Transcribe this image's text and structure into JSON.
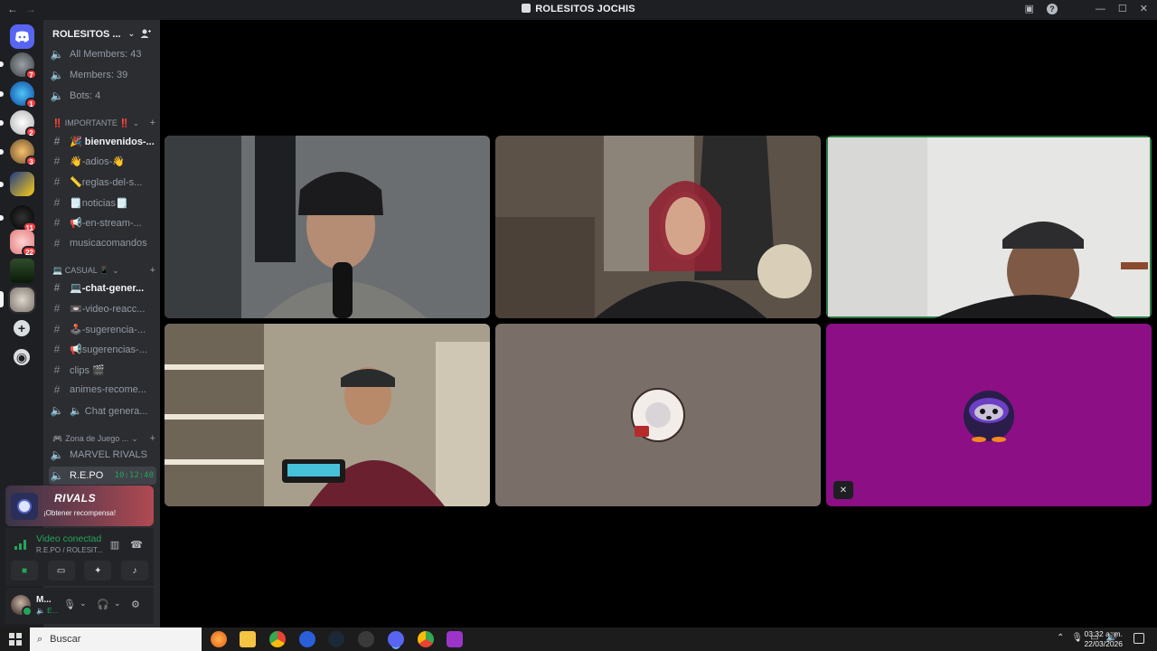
{
  "window": {
    "title": "ROLESITOS JOCHIS",
    "nav_back": "←",
    "nav_forward": "→",
    "controls": [
      "—",
      "☐",
      "✕"
    ]
  },
  "rail": {
    "badges": [
      "7",
      "1",
      "2",
      "3",
      "11",
      "22"
    ]
  },
  "sidebar": {
    "server_name": "ROLESITOS ...",
    "stats": [
      "All Members: 43",
      "Members: 39",
      "Bots: 4"
    ],
    "categories": {
      "importante": "‼️ IMPORTANTE ‼️",
      "casual": "💻 CASUAL 📱",
      "zona": "Zona de Juego ..."
    },
    "channels": [
      {
        "label": "🎉 bienvenidos-..."
      },
      {
        "label": "👋-adios-👋"
      },
      {
        "label": "📏reglas-del-s..."
      },
      {
        "label": "🗒️noticias🗒️"
      },
      {
        "label": "📢-en-stream-..."
      },
      {
        "label": "musicacomandos"
      },
      {
        "label": "💻-chat-gener..."
      },
      {
        "label": "📼-video-reacc..."
      },
      {
        "label": "🕹️-sugerencia-..."
      },
      {
        "label": "📢sugerencias-..."
      },
      {
        "label": "clips 🎬"
      },
      {
        "label": "animes-recome..."
      },
      {
        "label": "🔈 Chat genera..."
      }
    ],
    "voice_channels": [
      {
        "label": "MARVEL RIVALS"
      },
      {
        "label": "R.E.PO",
        "time": "10:12:40"
      }
    ]
  },
  "promo": {
    "brand": "RIVALS",
    "cta": "¡Obtener recompensa!"
  },
  "voice_panel": {
    "status": "Video conectado",
    "location": "R.E.PO / ROLESIT..."
  },
  "user_panel": {
    "name": "M...",
    "status": "🔈 E..."
  },
  "taskbar": {
    "search_placeholder": "Buscar",
    "time": "03:32 a. m.",
    "date": "22/03/2026"
  },
  "colors": {
    "rail_bg": "#1e1f22",
    "sidebar_bg": "#2b2d31",
    "speaking_border": "#2d7d46",
    "connected_green": "#23a55a",
    "tile_brown": "#7a6e68",
    "tile_magenta": "#8c0f85"
  }
}
